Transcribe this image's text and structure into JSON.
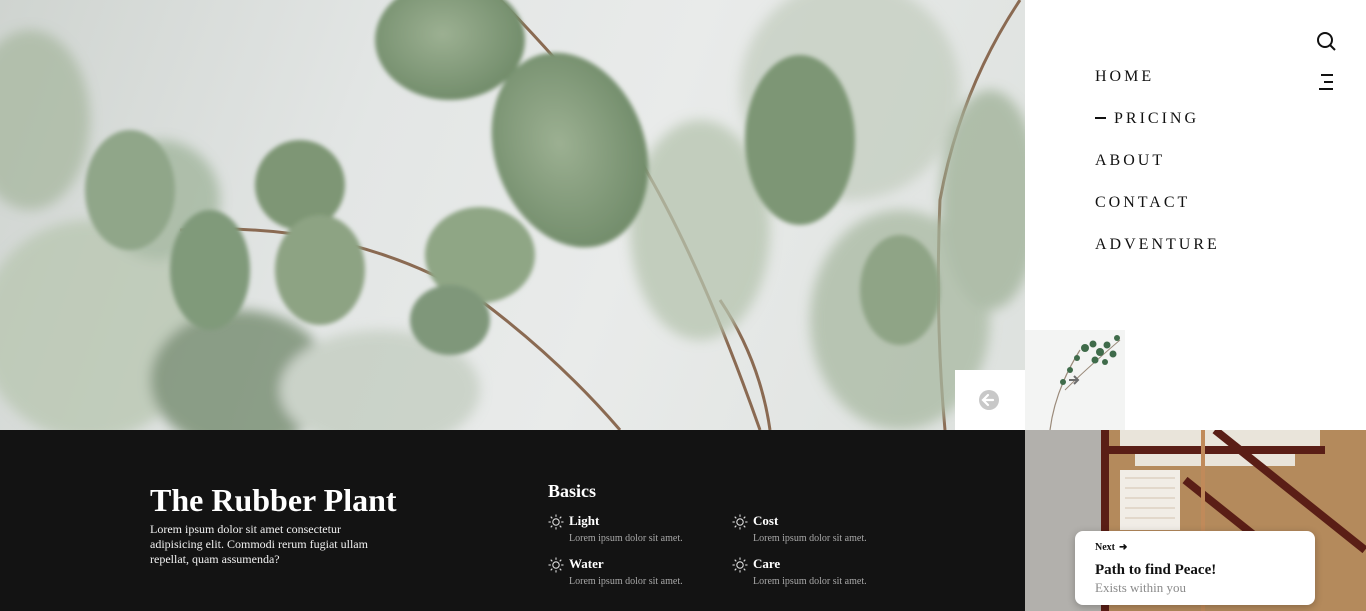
{
  "nav": {
    "items": [
      {
        "label": "HOME",
        "active": false
      },
      {
        "label": "PRICING",
        "active": true
      },
      {
        "label": "ABOUT",
        "active": false
      },
      {
        "label": "CONTACT",
        "active": false
      },
      {
        "label": "ADVENTURE",
        "active": false
      }
    ],
    "icons": {
      "search": "search-icon",
      "menu": "hamburger-icon"
    }
  },
  "hero": {
    "image": "eucalyptus-leaves"
  },
  "slider": {
    "prev_icon": "arrow-left-circle-icon",
    "next_icon": "arrow-right-icon",
    "next_thumb": "plant-thumbnail"
  },
  "plant": {
    "title": "The Rubber Plant",
    "description": "Lorem ipsum dolor sit amet consectetur adipisicing elit. Commodi rerum fugiat ullam repellat, quam assumenda?"
  },
  "basics": {
    "heading": "Basics",
    "items": [
      {
        "title": "Light",
        "text": "Lorem ipsum dolor sit amet.",
        "icon": "sun-icon"
      },
      {
        "title": "Cost",
        "text": "Lorem ipsum dolor sit amet.",
        "icon": "sun-icon"
      },
      {
        "title": "Water",
        "text": "Lorem ipsum dolor sit amet.",
        "icon": "sun-icon"
      },
      {
        "title": "Care",
        "text": "Lorem ipsum dolor sit amet.",
        "icon": "sun-icon"
      }
    ]
  },
  "next_card": {
    "label": "Next",
    "title": "Path to find Peace!",
    "subtitle": "Exists within you"
  },
  "colors": {
    "dark_band": "#131313",
    "leaf": "#8aa07e",
    "muted_text": "#a8a8a8"
  }
}
